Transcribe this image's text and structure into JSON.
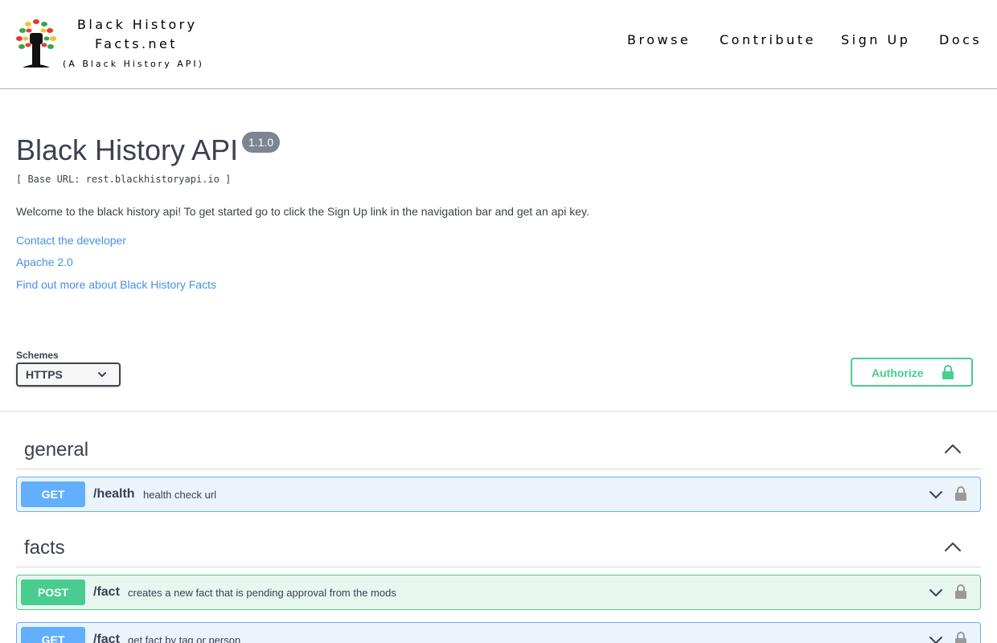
{
  "header": {
    "brand_line1": "Black History",
    "brand_line2": "Facts.net",
    "brand_sub": "(A Black History API)",
    "nav": [
      "Browse",
      "Contribute",
      "Sign Up",
      "Docs"
    ],
    "logo_icon": "tree-fist-logo"
  },
  "info": {
    "title": "Black History API",
    "version": "1.1.0",
    "base_url": "[ Base URL: rest.blackhistoryapi.io ]",
    "description": "Welcome to the black history api! To get started go to click the Sign Up link in the navigation bar and get an api key.",
    "links": {
      "contact": "Contact the developer",
      "license": "Apache 2.0",
      "more": "Find out more about Black History Facts"
    }
  },
  "schemes": {
    "label": "Schemes",
    "selected": "HTTPS",
    "authorize_label": "Authorize"
  },
  "tags": [
    {
      "name": "general"
    },
    {
      "name": "facts"
    }
  ],
  "operations": [
    {
      "method": "GET",
      "path": "/health",
      "summary": "health check url"
    },
    {
      "method": "POST",
      "path": "/fact",
      "summary": "creates a new fact that is pending approval from the mods"
    },
    {
      "method": "GET",
      "path": "/fact",
      "summary": "get fact by tag or person"
    }
  ],
  "colors": {
    "get": "#61affe",
    "post": "#49cc90",
    "link": "#4990e2",
    "text": "#3b4151"
  }
}
